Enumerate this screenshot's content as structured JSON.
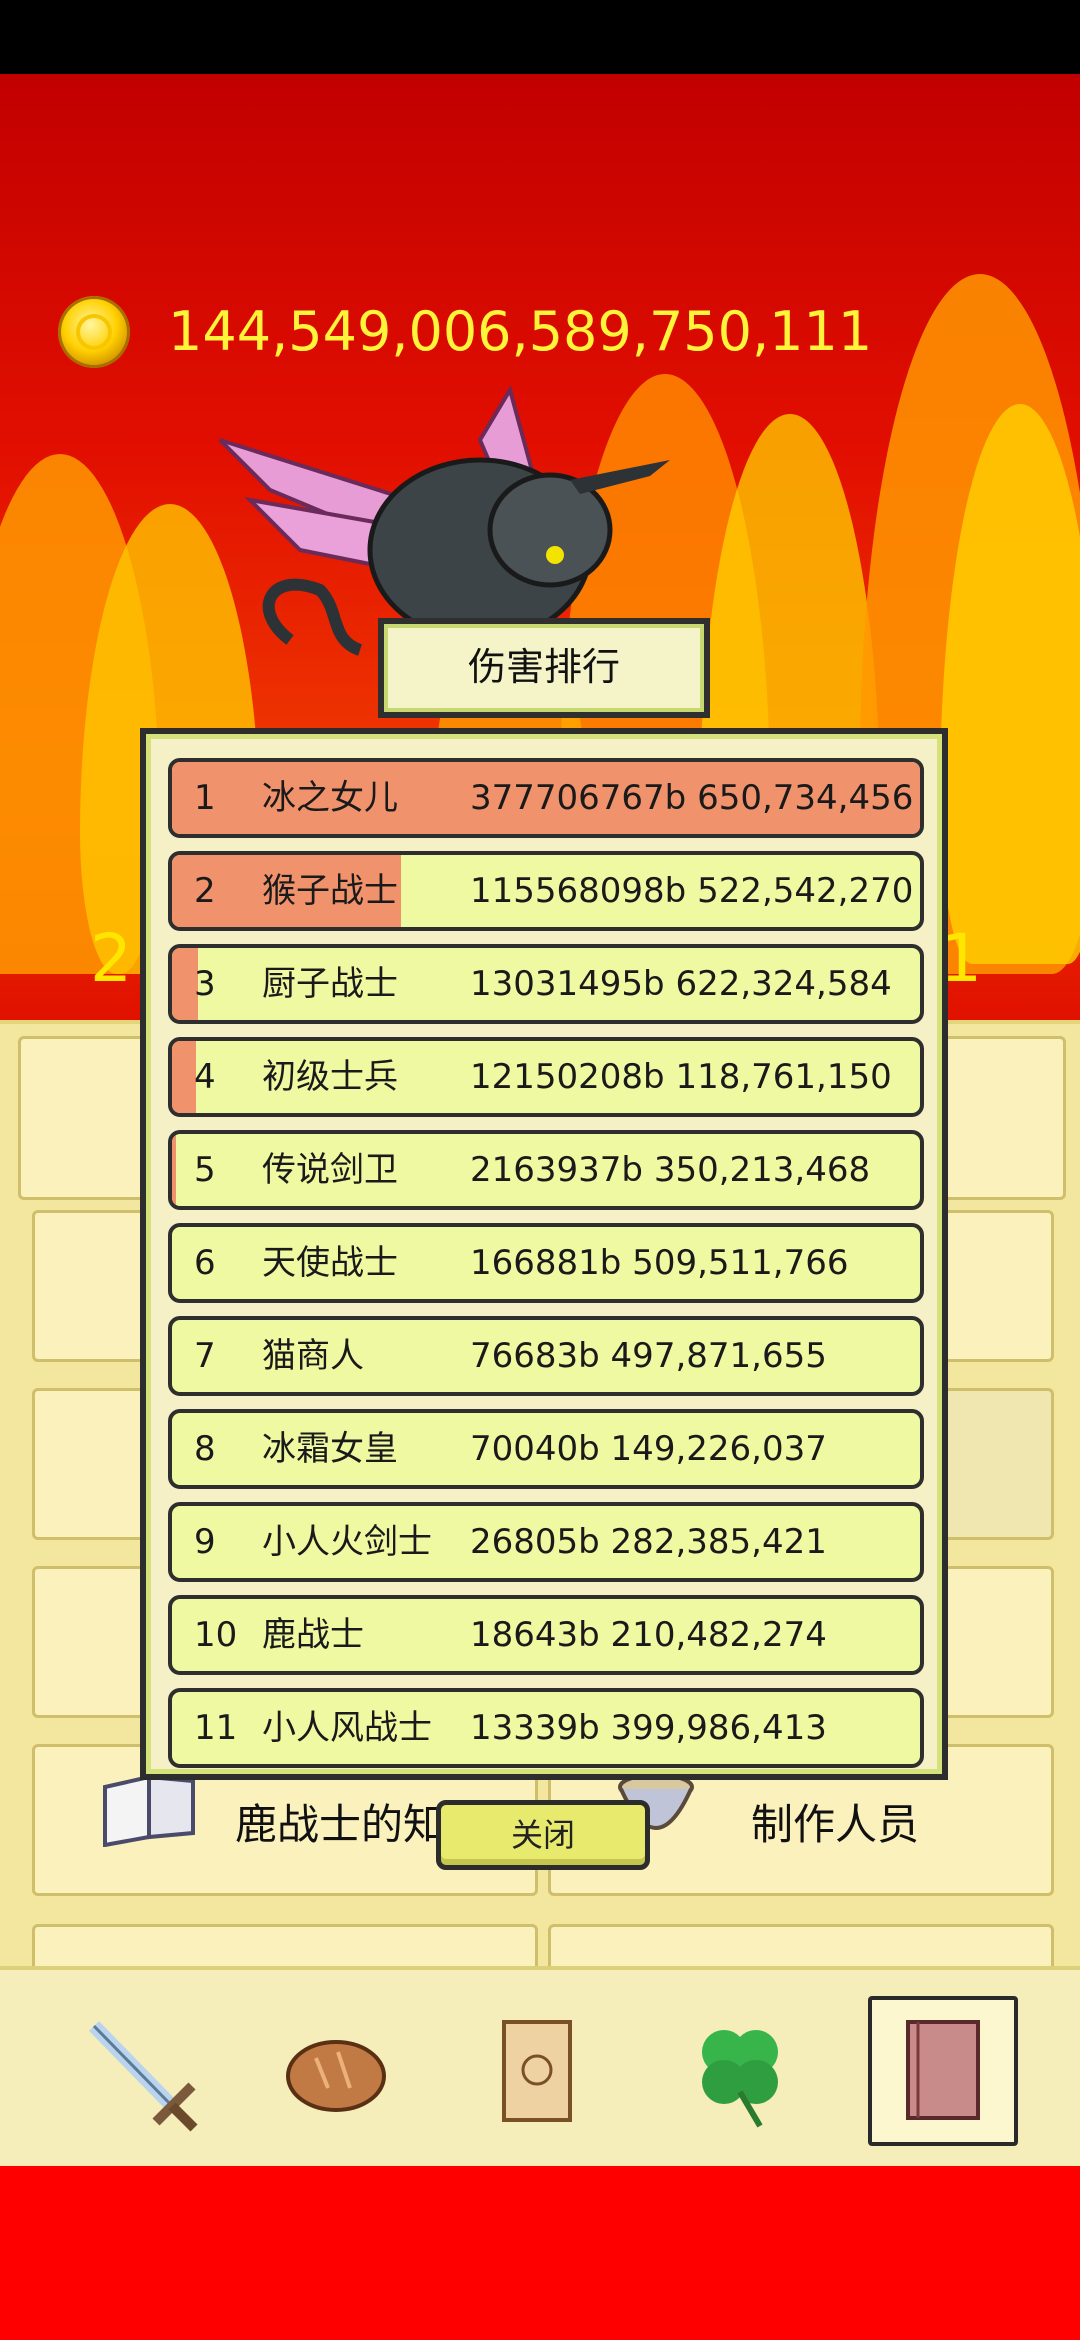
{
  "gold": {
    "amount": "144,549,006,589,750,111",
    "icon": "gold-coin-icon"
  },
  "side_numbers": {
    "left": "2",
    "right": "1"
  },
  "modal": {
    "title": "伤害排行",
    "close_label": "关闭",
    "rows": [
      {
        "rank": "1",
        "name": "冰之女儿",
        "damage": "377706767b 650,734,456",
        "share": 1.0
      },
      {
        "rank": "2",
        "name": "猴子战士",
        "damage": "115568098b 522,542,270",
        "share": 0.306
      },
      {
        "rank": "3",
        "name": "厨子战士",
        "damage": "13031495b 622,324,584",
        "share": 0.035
      },
      {
        "rank": "4",
        "name": "初级士兵",
        "damage": "12150208b 118,761,150",
        "share": 0.032
      },
      {
        "rank": "5",
        "name": "传说剑卫",
        "damage": "2163937b 350,213,468",
        "share": 0.006
      },
      {
        "rank": "6",
        "name": "天使战士",
        "damage": "166881b 509,511,766",
        "share": 0
      },
      {
        "rank": "7",
        "name": "猫商人",
        "damage": "76683b 497,871,655",
        "share": 0
      },
      {
        "rank": "8",
        "name": "冰霜女皇",
        "damage": "70040b 149,226,037",
        "share": 0
      },
      {
        "rank": "9",
        "name": "小人火剑士",
        "damage": "26805b 282,385,421",
        "share": 0
      },
      {
        "rank": "10",
        "name": "鹿战士",
        "damage": "18643b 210,482,274",
        "share": 0
      },
      {
        "rank": "11",
        "name": "小人风战士",
        "damage": "13339b 399,986,413",
        "share": 0
      }
    ]
  },
  "panel": {
    "card_left": "鹿战士的知识",
    "card_right": "制作人员"
  },
  "bottom_tabs": [
    {
      "name": "sword-icon",
      "selected": false
    },
    {
      "name": "bread-icon",
      "selected": false
    },
    {
      "name": "scroll-icon",
      "selected": false
    },
    {
      "name": "clover-icon",
      "selected": false
    },
    {
      "name": "book-icon",
      "selected": true
    }
  ],
  "colors": {
    "bar_fill": "#f0926b",
    "row_bg": "#eff9a2",
    "gold_text": "#fff43a"
  }
}
